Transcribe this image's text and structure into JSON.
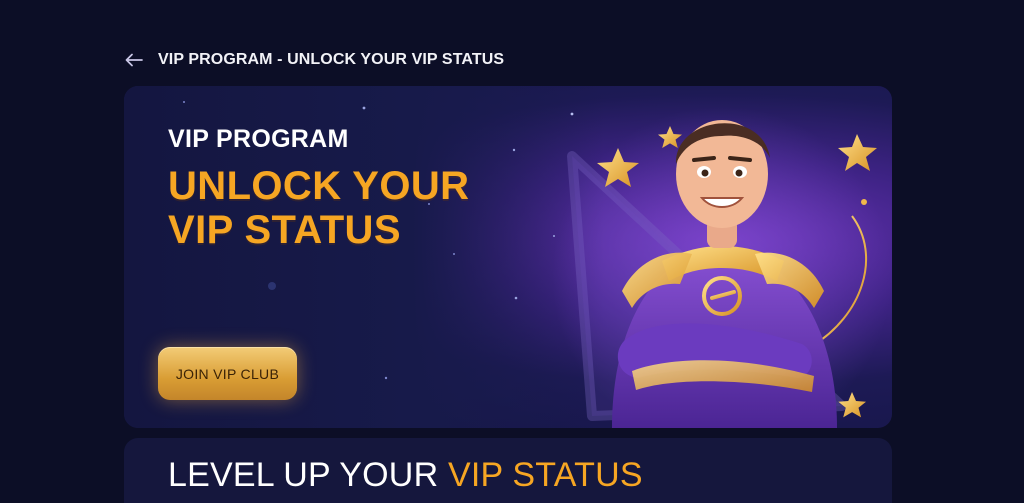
{
  "header": {
    "back_icon": "arrow-left-icon",
    "title": "VIP PROGRAM - UNLOCK YOUR VIP STATUS"
  },
  "hero": {
    "eyebrow": "VIP PROGRAM",
    "headline_line1": "UNLOCK YOUR",
    "headline_line2": "VIP STATUS",
    "cta_label": "JOIN VIP CLUB",
    "illustration": "vip-superhero-mascot-with-stars",
    "colors": {
      "accent_gold": "#f6a623",
      "background": "#0c0e26",
      "hero_purple": "#6a34b8"
    }
  },
  "section": {
    "heading_white": "LEVEL UP YOUR",
    "heading_gold": "VIP STATUS"
  }
}
